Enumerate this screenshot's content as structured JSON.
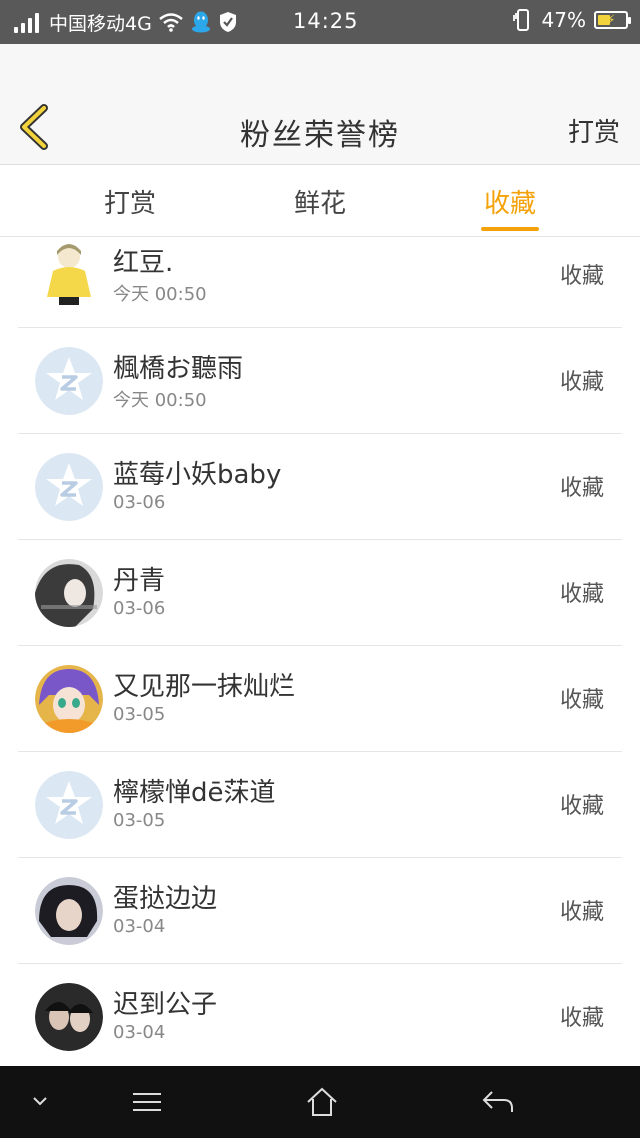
{
  "status_bar": {
    "carrier": "中国移动4G",
    "time": "14:25",
    "battery": "47%",
    "battery_level": 0.47,
    "icons": [
      "signal-icon",
      "wifi-icon",
      "qq-icon",
      "shield-icon",
      "phone-vibrate-icon",
      "battery-icon"
    ]
  },
  "header": {
    "back_icon": "chevron-left-icon",
    "title": "粉丝荣誉榜",
    "action": "打赏"
  },
  "tabs": [
    {
      "label": "打赏",
      "active": false
    },
    {
      "label": "鲜花",
      "active": false
    },
    {
      "label": "收藏",
      "active": true
    }
  ],
  "accent_color": "#f5a20a",
  "list": [
    {
      "name": "红豆.",
      "time": "今天 00:50",
      "action": "收藏",
      "avatar": "cartoon-girl"
    },
    {
      "name": "楓橋お聽雨",
      "time": "今天 00:50",
      "action": "收藏",
      "avatar": "default-z-avatar"
    },
    {
      "name": "蓝莓小妖baby",
      "time": "03-06",
      "action": "收藏",
      "avatar": "default-z-avatar"
    },
    {
      "name": "丹青",
      "time": "03-06",
      "action": "收藏",
      "avatar": "photo-girl-grey"
    },
    {
      "name": "又见那一抹灿烂",
      "time": "03-05",
      "action": "收藏",
      "avatar": "anime-girl"
    },
    {
      "name": "檸檬惮dē莯道",
      "time": "03-05",
      "action": "收藏",
      "avatar": "default-z-avatar"
    },
    {
      "name": "蛋挞边边",
      "time": "03-04",
      "action": "收藏",
      "avatar": "photo-girl-dark"
    },
    {
      "name": "迟到公子",
      "time": "03-04",
      "action": "收藏",
      "avatar": "photo-couple"
    }
  ],
  "navbar": {
    "icons": [
      "chevron-down-icon",
      "menu-icon",
      "home-icon",
      "back-icon"
    ]
  }
}
